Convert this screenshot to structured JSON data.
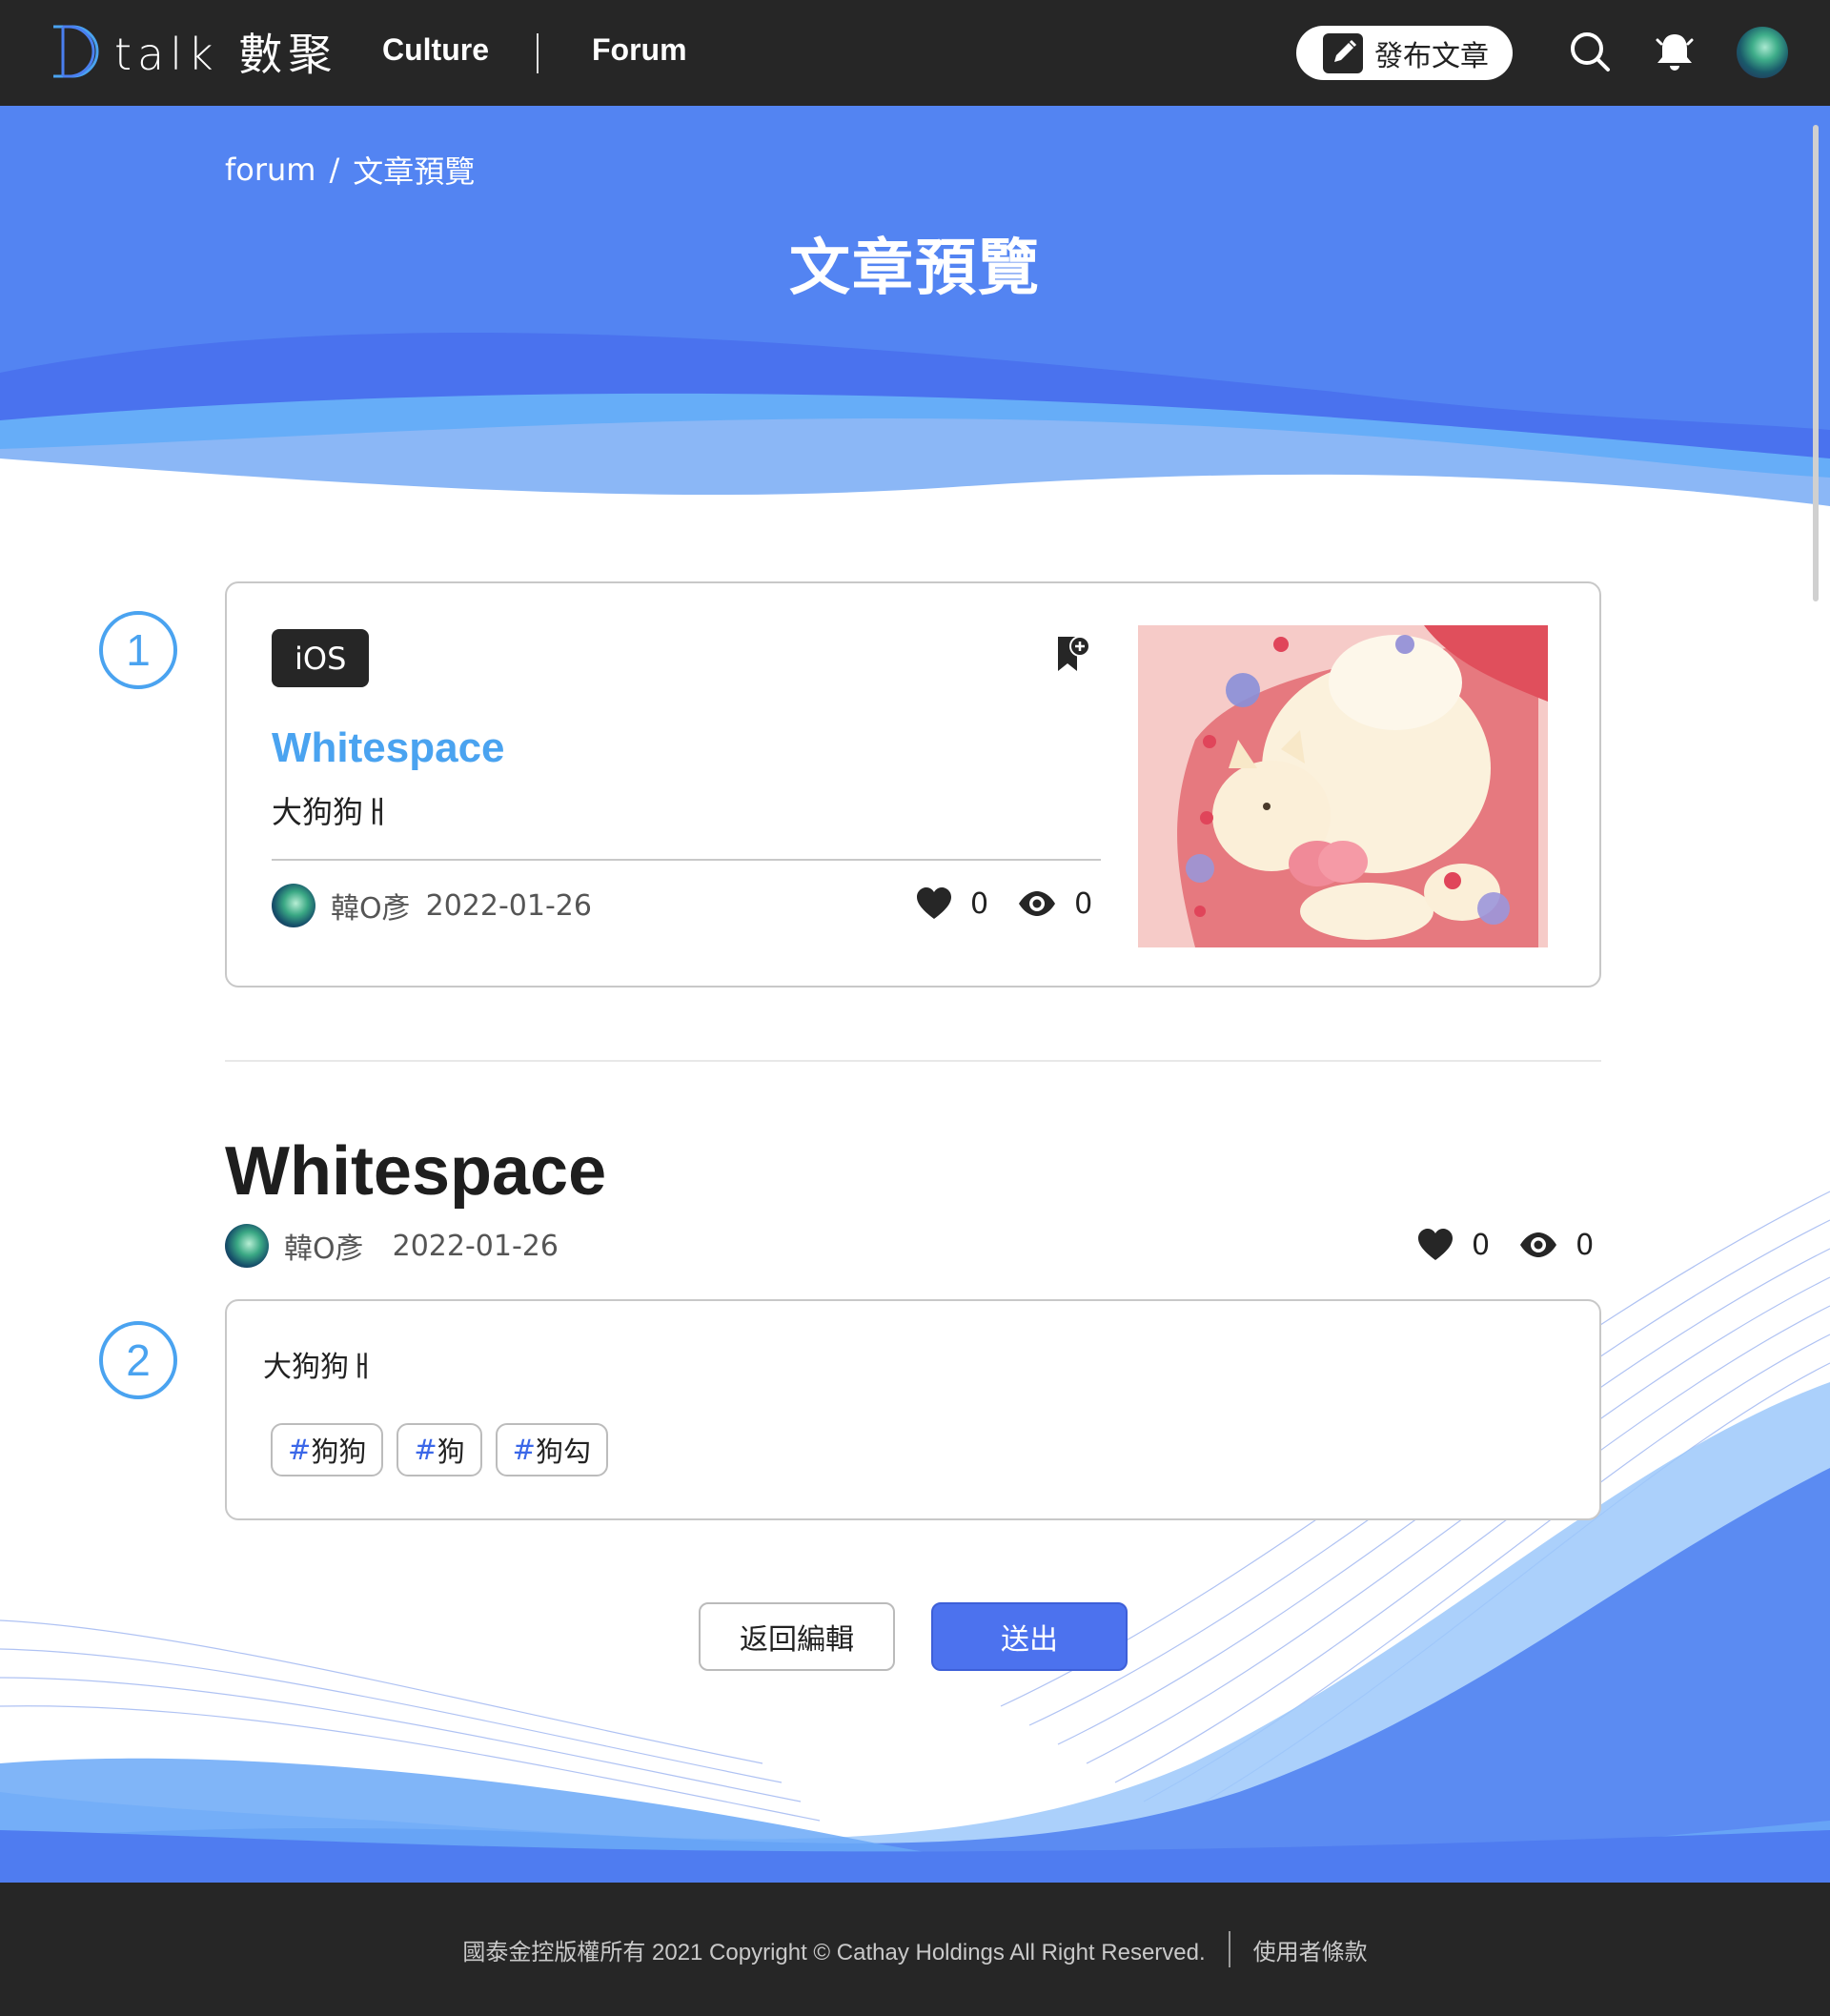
{
  "nav": {
    "logo_text": "talk 數聚",
    "links": [
      "Culture",
      "Forum"
    ],
    "publish_label": "發布文章"
  },
  "hero": {
    "breadcrumb_root": "forum",
    "breadcrumb_separator": "/",
    "breadcrumb_current": "文章預覽",
    "title": "文章預覽"
  },
  "steps": [
    "1",
    "2"
  ],
  "card": {
    "tag": "iOS",
    "title": "Whitespace",
    "excerpt": "大狗狗ㅐ",
    "author": "韓O彥",
    "date": "2022-01-26",
    "likes": "0",
    "views": "0"
  },
  "article": {
    "title": "Whitespace",
    "author": "韓O彥",
    "date": "2022-01-26",
    "likes": "0",
    "views": "0",
    "body": "大狗狗ㅐ",
    "hashtags": [
      {
        "hash": "#",
        "label": "狗狗"
      },
      {
        "hash": "#",
        "label": "狗"
      },
      {
        "hash": "#",
        "label": "狗勾"
      }
    ]
  },
  "actions": {
    "back_label": "返回編輯",
    "submit_label": "送出"
  },
  "footer": {
    "copyright": "國泰金控版權所有 2021 Copyright © Cathay Holdings All Right Reserved.",
    "terms": "使用者條款"
  },
  "colors": {
    "nav_bg": "#262626",
    "hero_bg": "#5384f2",
    "accent_blue": "#4aa3f0",
    "submit_blue": "#4c72ee"
  },
  "icons": [
    "logo-d-icon",
    "pen-square-icon",
    "search-icon",
    "bell-icon",
    "bookmark-plus-icon",
    "heart-icon",
    "eye-icon"
  ]
}
